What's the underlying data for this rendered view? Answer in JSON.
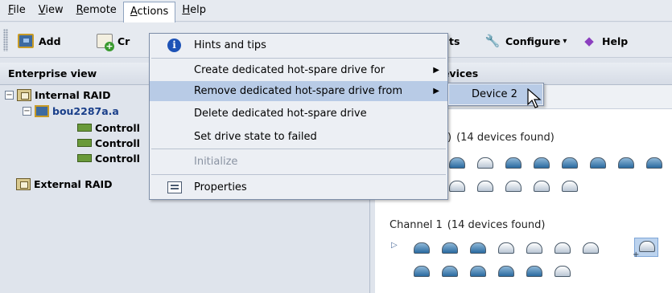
{
  "menubar": {
    "items": [
      {
        "label": "File",
        "mnemonic": "F",
        "rest": "ile"
      },
      {
        "label": "View",
        "mnemonic": "V",
        "rest": "iew"
      },
      {
        "label": "Remote",
        "mnemonic": "R",
        "rest": "emote"
      },
      {
        "label": "Actions",
        "mnemonic": "A",
        "rest": "ctions"
      },
      {
        "label": "Help",
        "mnemonic": "H",
        "rest": "elp"
      }
    ]
  },
  "toolbar": {
    "add_label": "Add",
    "create_label": "Cr",
    "events_label": "ts",
    "configure_label": "Configure",
    "help_label": "Help"
  },
  "left_panel": {
    "title": "Enterprise view",
    "tree": {
      "internal_raid": "Internal RAID",
      "server": "bou2287a.a",
      "controllers": [
        "Controll",
        "Controll",
        "Controll"
      ],
      "external_raid": "External RAID"
    }
  },
  "right_panel": {
    "title": "devices",
    "channel0_label": ")",
    "channel0_found": "(14 devices found)",
    "channel1_label": "Channel 1",
    "channel1_found": "(14 devices found)"
  },
  "actions_menu": {
    "hints": "Hints and tips",
    "create_hotspare": "Create dedicated hot-spare drive for",
    "remove_hotspare": "Remove dedicated hot-spare drive from",
    "delete_hotspare": "Delete dedicated hot-spare drive",
    "set_failed": "Set drive state to failed",
    "initialize": "Initialize",
    "properties": "Properties"
  },
  "submenu": {
    "device": "Device 2"
  },
  "colors": {
    "menu_highlight": "#b8cbe6",
    "panel_bg": "#dfe4ec",
    "accent_blue": "#1d52b6"
  }
}
